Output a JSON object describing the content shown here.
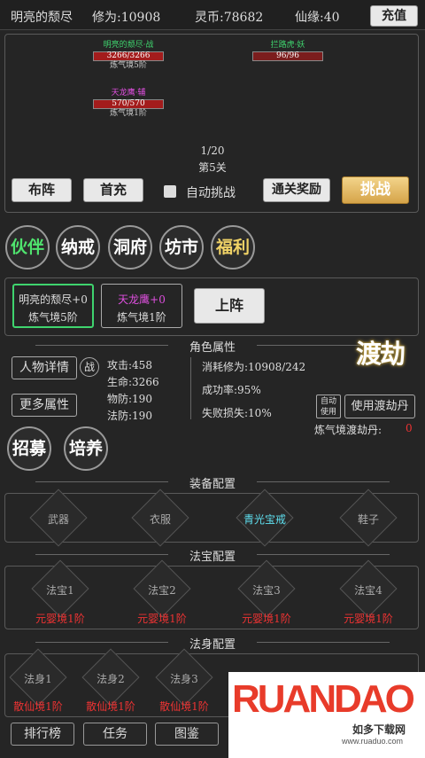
{
  "topbar": {
    "name": "明亮的颓尽",
    "cultivation": "修为:10908",
    "spirit_coin": "灵币:78682",
    "fate": "仙缘:40",
    "recharge": "充值"
  },
  "battle": {
    "ally1": {
      "name": "明亮的颓尽·战",
      "hp": "3266/3266",
      "level": "炼气境5阶"
    },
    "ally2": {
      "name": "天龙鹰·辅",
      "hp": "570/570",
      "level": "炼气境1阶"
    },
    "enemy": {
      "name": "拦路虎·妖",
      "hp": "96/96"
    },
    "wave": "1/20",
    "stage": "第5关"
  },
  "battle_buttons": {
    "formation": "布阵",
    "first_charge": "首充",
    "auto": "自动挑战",
    "clear_reward": "通关奖励",
    "challenge": "挑战"
  },
  "menu": {
    "partner": "伙伴",
    "ring": "纳戒",
    "cave": "洞府",
    "market": "坊市",
    "welfare": "福利"
  },
  "team": {
    "m1_name": "明亮的颓尽+0",
    "m1_level": "炼气境5阶",
    "m2_name": "天龙鹰+0",
    "m2_level": "炼气境1阶",
    "deploy": "上阵"
  },
  "attrs": {
    "header": "角色属性",
    "detail": "人物详情",
    "war": "战",
    "more": "更多属性",
    "recruit": "招募",
    "train": "培养",
    "atk": "攻击:458",
    "hp": "生命:3266",
    "pdef": "物防:190",
    "mdef": "法防:190",
    "cost": "消耗修为:10908/242",
    "rate": "成功率:95%",
    "loss": "失败损失:10%",
    "tribulation": "渡劫",
    "auto_use": "自动使用",
    "use_pill": "使用渡劫丹",
    "pill_label": "炼气境渡劫丹:",
    "pill_count": "0"
  },
  "equip": {
    "header": "装备配置",
    "slots": [
      "武器",
      "衣服",
      "青光宝戒",
      "鞋子"
    ]
  },
  "treasure": {
    "header": "法宝配置",
    "slots": [
      "法宝1",
      "法宝2",
      "法宝3",
      "法宝4"
    ],
    "req": "元婴境1阶"
  },
  "body": {
    "header": "法身配置",
    "slots": [
      "法身1",
      "法身2",
      "法身3"
    ],
    "req": "散仙境1阶"
  },
  "nav": {
    "rank": "排行榜",
    "task": "任务",
    "guide": "图鉴"
  },
  "watermark": {
    "brand": "RUANDAO",
    "sub": "如多下载网",
    "url": "www.ruaduo.com"
  },
  "colors": {
    "accent_green": "#3fd46e",
    "accent_gold": "#f0d266",
    "red": "#e33"
  }
}
